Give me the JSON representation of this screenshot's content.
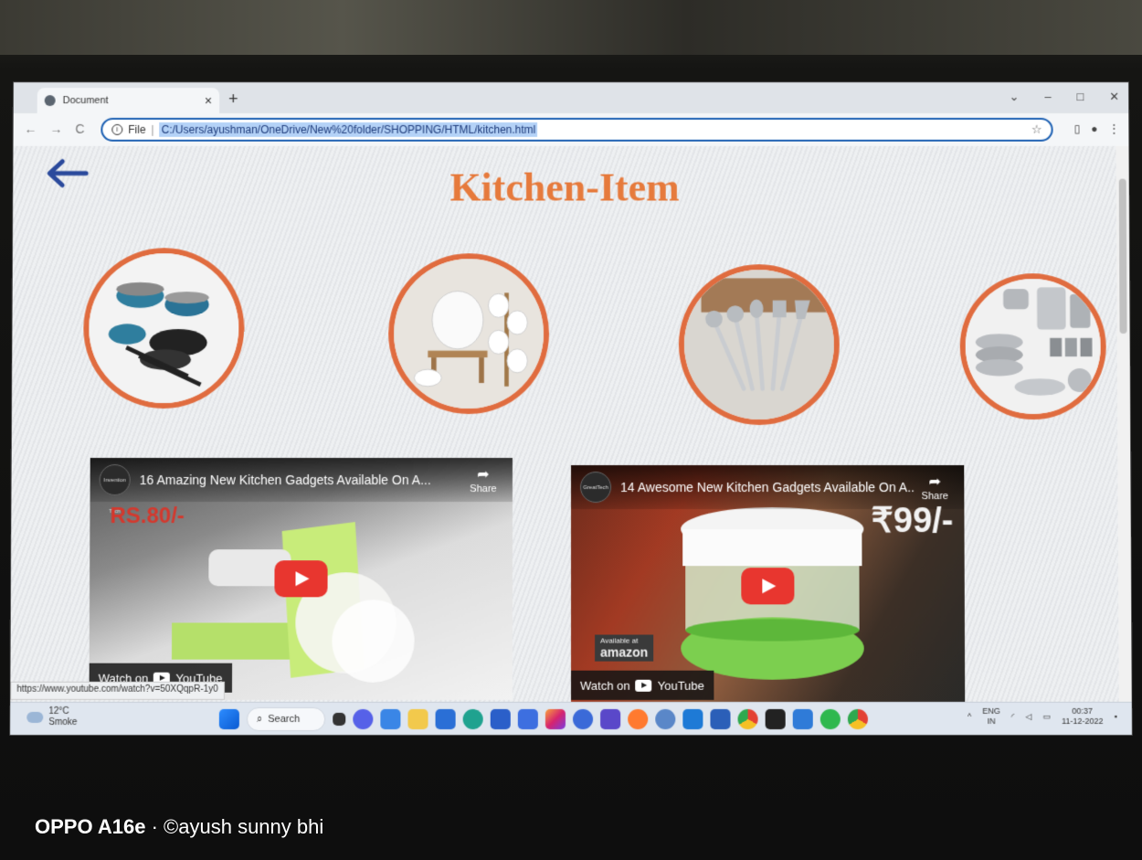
{
  "browser": {
    "tab_title": "Document",
    "tab_close": "×",
    "new_tab": "+",
    "window_controls": [
      "⌄",
      "–",
      "□",
      "✕"
    ],
    "nav": {
      "back": "←",
      "forward": "→",
      "reload": "C"
    },
    "address": {
      "prefix": "File",
      "url": "C:/Users/ayushman/OneDrive/New%20folder/SHOPPING/HTML/kitchen.html"
    }
  },
  "page": {
    "title": "Kitchen-Item",
    "categories": [
      "cookware-pots-pans",
      "ceramic-dispenser-cups",
      "ladle-utensil-set",
      "steel-containers"
    ],
    "videos": [
      {
        "title": "16 Amazing New Kitchen Gadgets Available On A...",
        "channel": "Invention Tech",
        "price": "RS.80/-",
        "share": "Share",
        "watch_on": "Watch on",
        "youtube": "YouTube"
      },
      {
        "title": "14 Awesome New Kitchen Gadgets Available On A...",
        "channel": "GreatTech",
        "price": "₹99/-",
        "share": "Share",
        "watch_on": "Watch on",
        "youtube": "YouTube",
        "badge_top": "Available at",
        "badge_bottom": "amazon"
      }
    ],
    "status_url": "https://www.youtube.com/watch?v=50XQqpR-1y0"
  },
  "taskbar": {
    "weather_temp": "12°C",
    "weather_desc": "Smoke",
    "search_label": "Search",
    "lang_top": "ENG",
    "lang_bottom": "IN",
    "time": "00:37",
    "date": "11-12-2022"
  },
  "watermark": {
    "device": "OPPO A16e",
    "credit": "©ayush sunny bhi"
  },
  "colors": {
    "title": "#e67a3c",
    "circle_border": "#e06c3f",
    "back_arrow": "#2b4a9c",
    "play_button": "#e8362f"
  }
}
